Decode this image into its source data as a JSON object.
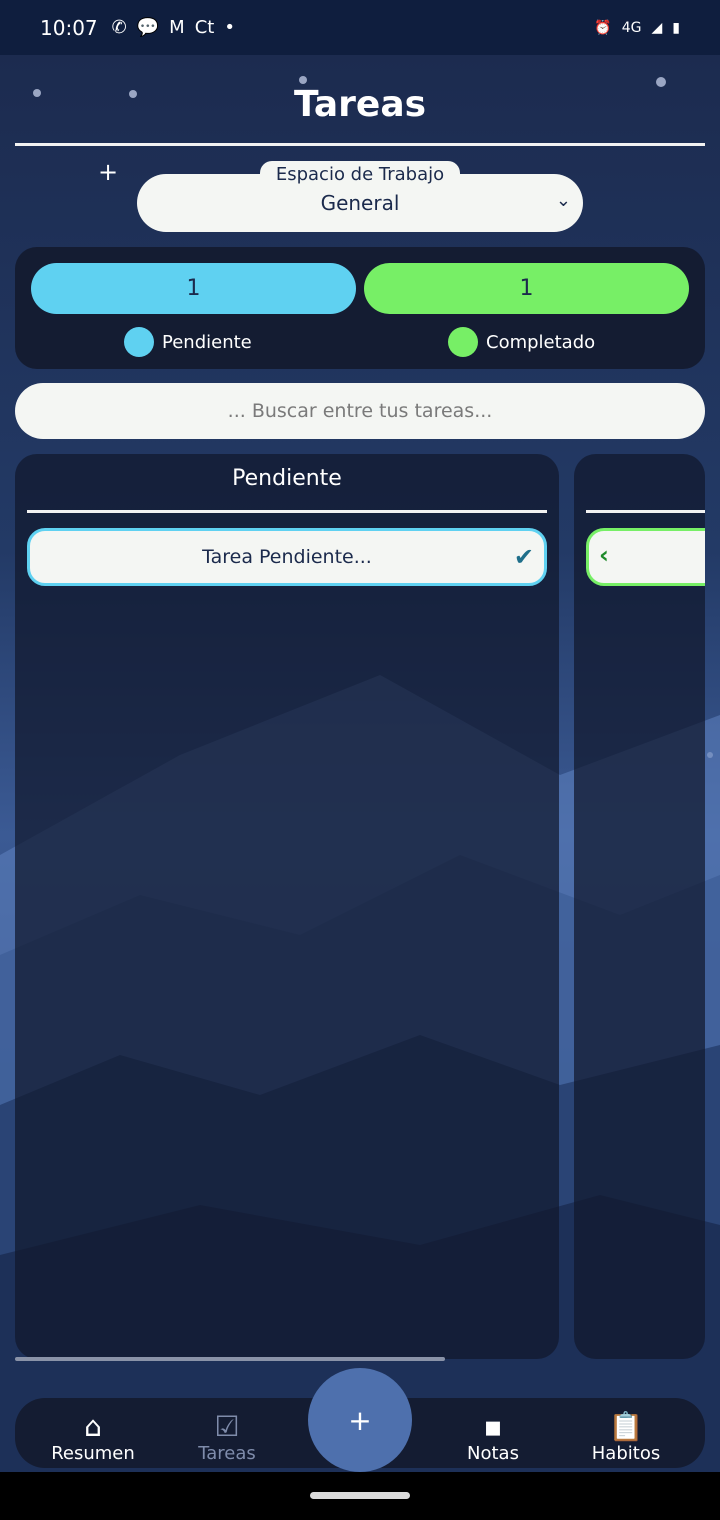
{
  "status_bar": {
    "time": "10:07",
    "notification_icons": [
      "whatsapp-icon",
      "chat-icon",
      "gmail-icon",
      "ct-icon",
      "dot-icon"
    ],
    "ct_label": "Ct",
    "network": "4G",
    "right_icons": [
      "alarm-icon",
      "signal-icon",
      "battery-icon"
    ]
  },
  "header": {
    "title": "Tareas"
  },
  "workspace": {
    "label": "Espacio de Trabajo",
    "selected": "General"
  },
  "stats": {
    "pending_count": "1",
    "completed_count": "1",
    "pending_label": "Pendiente",
    "completed_label": "Completado",
    "pending_color": "#5fd1f1",
    "completed_color": "#77ef66"
  },
  "search": {
    "placeholder": "... Buscar entre tus tareas..."
  },
  "columns": {
    "pending": {
      "title": "Pendiente",
      "tasks": [
        {
          "text": "Tarea Pendiente..."
        }
      ]
    }
  },
  "bottom_nav": {
    "items": [
      {
        "label": "Resumen",
        "icon": "home-icon"
      },
      {
        "label": "Tareas",
        "icon": "task-check-icon"
      },
      {
        "label": "Notas",
        "icon": "note-icon"
      },
      {
        "label": "Habitos",
        "icon": "clipboard-list-icon"
      }
    ],
    "fab_label": "+"
  },
  "colors": {
    "accent_blue": "#4e70ad",
    "card_dark": "#141c32",
    "status_bar": "#0f1e3e"
  }
}
